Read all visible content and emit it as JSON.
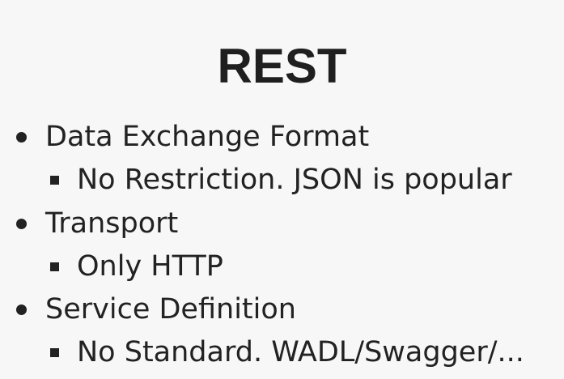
{
  "slide": {
    "title": "REST",
    "bullets": [
      {
        "label": "Data Exchange Format",
        "sub": "No Restriction. JSON is popular"
      },
      {
        "label": "Transport",
        "sub": "Only HTTP"
      },
      {
        "label": "Service Definition",
        "sub": "No Standard. WADL/Swagger/..."
      }
    ]
  },
  "colors": {
    "background": "#f7f7f7",
    "text": "#222222"
  }
}
